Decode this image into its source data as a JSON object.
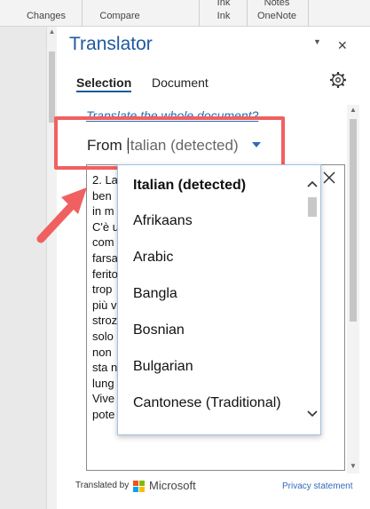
{
  "ribbon": {
    "groups": [
      {
        "line1": "",
        "line2": "Changes"
      },
      {
        "line1": "",
        "line2": "Compare"
      },
      {
        "line1": "Ink",
        "line2": "Ink"
      },
      {
        "line1": "Notes",
        "line2": "OneNote"
      }
    ]
  },
  "pane": {
    "title": "Translator",
    "tabs": [
      {
        "label": "Selection",
        "active": true
      },
      {
        "label": "Document",
        "active": false
      }
    ],
    "link_text": "Translate the whole document?",
    "from_label": "From",
    "from_value": "Italian (detected)",
    "source_lines": [
      "2. La",
      "ben",
      "in m",
      "C'è u",
      "com",
      "farsa",
      "ferito",
      "trop",
      "più v",
      "strozi",
      "solo",
      "non",
      "sta n",
      "lung",
      "Vive",
      "pote"
    ],
    "footer_text": "Translated by",
    "brand": "Microsoft",
    "privacy": "Privacy statement"
  },
  "dropdown": {
    "items": [
      {
        "label": "Italian (detected)",
        "selected": true
      },
      {
        "label": "Afrikaans",
        "selected": false
      },
      {
        "label": "Arabic",
        "selected": false
      },
      {
        "label": "Bangla",
        "selected": false
      },
      {
        "label": "Bosnian",
        "selected": false
      },
      {
        "label": "Bulgarian",
        "selected": false
      },
      {
        "label": "Cantonese (Traditional)",
        "selected": false
      }
    ]
  },
  "colors": {
    "accent": "#1f5aa0",
    "link": "#2d6bb5",
    "highlight": "#f06060"
  },
  "icons": {
    "settings": "gear-icon",
    "close": "close-icon",
    "dropdown": "chevron-down-icon"
  }
}
